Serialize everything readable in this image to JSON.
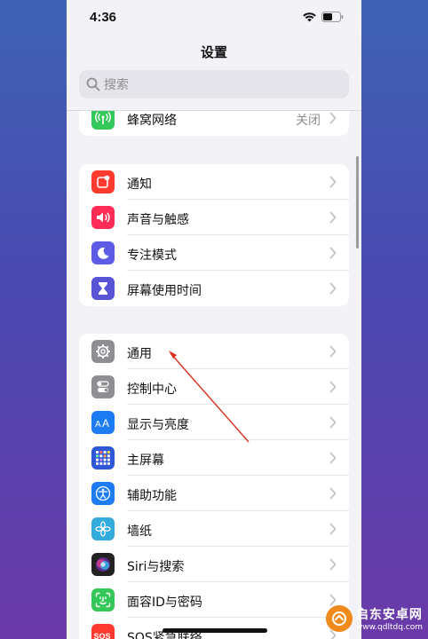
{
  "status_bar": {
    "time": "4:36"
  },
  "nav": {
    "title": "设置"
  },
  "search": {
    "placeholder": "搜索"
  },
  "group_cellular": {
    "items": [
      {
        "label": "蜂窝网络",
        "value": "关闭",
        "icon": "antenna-icon",
        "color": "#34c759"
      }
    ]
  },
  "group_notifications": {
    "items": [
      {
        "label": "通知",
        "icon": "bell-icon",
        "color": "#ff3b30"
      },
      {
        "label": "声音与触感",
        "icon": "speaker-icon",
        "color": "#ff2d55"
      },
      {
        "label": "专注模式",
        "icon": "moon-icon",
        "color": "#5e5ce6"
      },
      {
        "label": "屏幕使用时间",
        "icon": "hourglass-icon",
        "color": "#5856d6"
      }
    ]
  },
  "group_general": {
    "items": [
      {
        "label": "通用",
        "icon": "gear-icon",
        "color": "#8e8e93"
      },
      {
        "label": "控制中心",
        "icon": "toggles-icon",
        "color": "#8e8e93"
      },
      {
        "label": "显示与亮度",
        "icon": "text-size-icon",
        "color": "#1e7cf2"
      },
      {
        "label": "主屏幕",
        "icon": "home-grid-icon",
        "color": "#2f58d6"
      },
      {
        "label": "辅助功能",
        "icon": "accessibility-icon",
        "color": "#1e7cf2"
      },
      {
        "label": "墙纸",
        "icon": "flower-icon",
        "color": "#35aadc"
      },
      {
        "label": "Siri与搜索",
        "icon": "siri-icon",
        "color": "#222222"
      },
      {
        "label": "面容ID与密码",
        "icon": "faceid-icon",
        "color": "#34c759"
      },
      {
        "label": "SOS紧急联络",
        "icon": "sos-icon",
        "color": "#ff3b30"
      }
    ]
  },
  "watermark": {
    "name": "启东安卓网",
    "url": "www.qdltdq.com"
  }
}
